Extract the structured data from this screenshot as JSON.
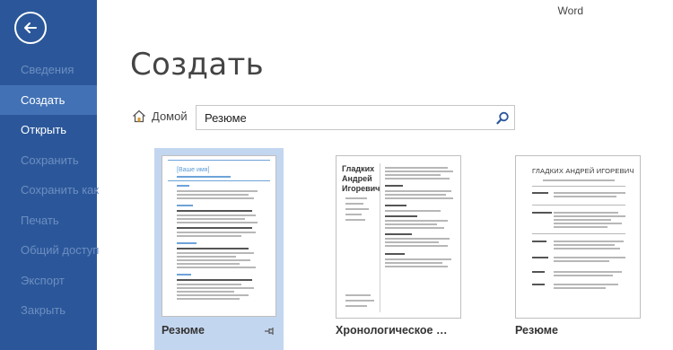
{
  "app": {
    "name": "Word"
  },
  "sidebar": {
    "items": [
      {
        "label": "Сведения",
        "state": "disabled"
      },
      {
        "label": "Создать",
        "state": "active"
      },
      {
        "label": "Открыть",
        "state": "enabled"
      },
      {
        "label": "Сохранить",
        "state": "disabled"
      },
      {
        "label": "Сохранить как",
        "state": "disabled"
      },
      {
        "label": "Печать",
        "state": "disabled"
      },
      {
        "label": "Общий доступ",
        "state": "disabled"
      },
      {
        "label": "Экспорт",
        "state": "disabled"
      },
      {
        "label": "Закрыть",
        "state": "disabled"
      }
    ]
  },
  "main": {
    "title": "Создать",
    "home_label": "Домой",
    "search": {
      "value": "Резюме"
    }
  },
  "templates": [
    {
      "label": "Резюме",
      "preview_heading": "[Ваше имя]",
      "selected": true
    },
    {
      "label": "Хронологическое рез...",
      "preview_heading_1": "Гладких",
      "preview_heading_2": "Андрей",
      "preview_heading_3": "Игоревич"
    },
    {
      "label": "Резюме",
      "preview_heading": "ГЛАДКИХ АНДРЕЙ ИГОРЕВИЧ"
    }
  ],
  "colors": {
    "sidebar_bg": "#2b579a",
    "sidebar_active": "#4272b5",
    "sidebar_disabled_text": "#6d8ec0",
    "selection_bg": "#c3d6ef",
    "accent_blue": "#2b579a"
  }
}
